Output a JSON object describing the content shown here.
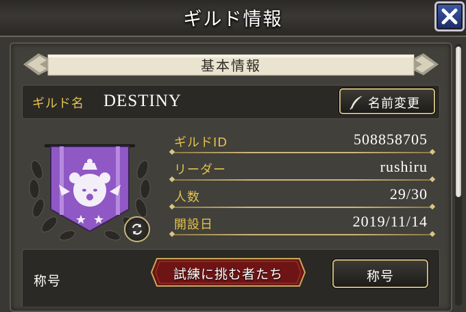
{
  "window": {
    "title": "ギルド情報",
    "close_icon": "close-icon"
  },
  "section": {
    "title": "基本情報"
  },
  "guild_name": {
    "label": "ギルド名",
    "value": "DESTINY",
    "rename_button": "名前変更",
    "icon": "quill-pen-icon"
  },
  "info": [
    {
      "label": "ギルドID",
      "value": "508858705"
    },
    {
      "label": "リーダー",
      "value": "rushiru"
    },
    {
      "label": "人数",
      "value": "29/30"
    },
    {
      "label": "開設日",
      "value": "2019/11/14"
    }
  ],
  "emblem": {
    "icon": "guild-emblem-moogle-banner",
    "change_icon": "emblem-change-icon"
  },
  "guild_title": {
    "label": "称号",
    "current_title": "試練に挑む者たち",
    "button": "称号"
  },
  "colors": {
    "gold": "#e2c34b",
    "panel": "#42403b",
    "row_bg": "#2b2926",
    "close_blue": "#2a3f8a",
    "badge_red": "#6e1414",
    "banner_purple": "#8f58c4"
  }
}
